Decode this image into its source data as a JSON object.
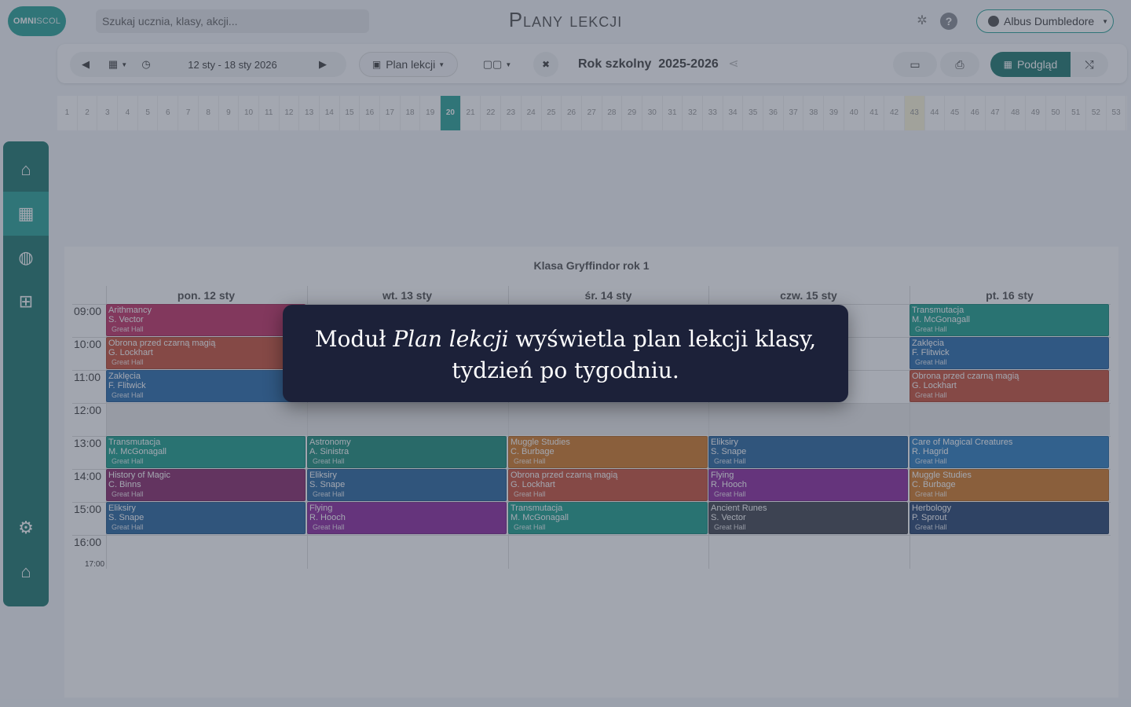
{
  "logo": {
    "bold": "OMNI",
    "lite": "SCOL"
  },
  "search": {
    "placeholder": "Szukaj ucznia, klasy, akcji..."
  },
  "page_title": "Plany lekcji",
  "user": {
    "name": "Albus Dumbledore"
  },
  "toolbar": {
    "date_range": "12 sty - 18 sty 2026",
    "plan_type": "Plan lekcji",
    "school_year_label": "Rok szkolny",
    "school_year_value": "2025-2026",
    "preview_label": "Podgląd"
  },
  "weeks": {
    "numbers": [
      "1",
      "2",
      "3",
      "4",
      "5",
      "6",
      "7",
      "8",
      "9",
      "10",
      "11",
      "12",
      "13",
      "14",
      "15",
      "16",
      "17",
      "18",
      "19",
      "20",
      "21",
      "22",
      "23",
      "24",
      "25",
      "26",
      "27",
      "28",
      "29",
      "30",
      "31",
      "32",
      "33",
      "34",
      "35",
      "36",
      "37",
      "38",
      "39",
      "40",
      "41",
      "42",
      "43",
      "44",
      "45",
      "46",
      "47",
      "48",
      "49",
      "50",
      "51",
      "52",
      "53"
    ],
    "active": "20",
    "highlighted": "43"
  },
  "sidebar": {
    "items": [
      "home-icon",
      "calendar-icon",
      "dashboard-icon",
      "screen-icon",
      "settings-icon",
      "institution-icon"
    ]
  },
  "timetable": {
    "title": "Klasa Gryffindor rok 1",
    "days": [
      "pon. 12 sty",
      "wt. 13 sty",
      "śr. 14 sty",
      "czw. 15 sty",
      "pt. 16 sty"
    ],
    "times": [
      "09:00",
      "10:00",
      "11:00",
      "12:00",
      "13:00",
      "14:00",
      "15:00",
      "16:00"
    ],
    "end_time": "17:00",
    "lessons": [
      {
        "day": 0,
        "slot": 0,
        "subject": "Arithmancy",
        "teacher": "S. Vector",
        "room": "Great Hall",
        "color": "#c33668"
      },
      {
        "day": 0,
        "slot": 1,
        "subject": "Obrona przed czarną magią",
        "teacher": "G. Lockhart",
        "room": "Great Hall",
        "color": "#c8553f"
      },
      {
        "day": 0,
        "slot": 2,
        "subject": "Zaklęcia",
        "teacher": "F. Flitwick",
        "room": "Great Hall",
        "color": "#2f6fae"
      },
      {
        "day": 4,
        "slot": 0,
        "subject": "Transmutacja",
        "teacher": "M. McGonagall",
        "room": "Great Hall",
        "color": "#22a08f"
      },
      {
        "day": 4,
        "slot": 1,
        "subject": "Zaklęcia",
        "teacher": "F. Flitwick",
        "room": "Great Hall",
        "color": "#2f6fae"
      },
      {
        "day": 4,
        "slot": 2,
        "subject": "Obrona przed czarną magią",
        "teacher": "G. Lockhart",
        "room": "Great Hall",
        "color": "#c8553f"
      },
      {
        "day": 0,
        "slot": 4,
        "subject": "Transmutacja",
        "teacher": "M. McGonagall",
        "room": "Great Hall",
        "color": "#22a08f"
      },
      {
        "day": 1,
        "slot": 4,
        "subject": "Astronomy",
        "teacher": "A. Sinistra",
        "room": "Great Hall",
        "color": "#21917f"
      },
      {
        "day": 2,
        "slot": 4,
        "subject": "Muggle Studies",
        "teacher": "C. Burbage",
        "room": "Great Hall",
        "color": "#d27d2c"
      },
      {
        "day": 3,
        "slot": 4,
        "subject": "Eliksiry",
        "teacher": "S. Snape",
        "room": "Great Hall",
        "color": "#2e6aa1"
      },
      {
        "day": 4,
        "slot": 4,
        "subject": "Care of Magical Creatures",
        "teacher": "R. Hagrid",
        "room": "Great Hall",
        "color": "#3280c0"
      },
      {
        "day": 0,
        "slot": 5,
        "subject": "History of Magic",
        "teacher": "C. Binns",
        "room": "Great Hall",
        "color": "#8a2f6e"
      },
      {
        "day": 1,
        "slot": 5,
        "subject": "Eliksiry",
        "teacher": "S. Snape",
        "room": "Great Hall",
        "color": "#2e6aa1"
      },
      {
        "day": 2,
        "slot": 5,
        "subject": "Obrona przed czarną magią",
        "teacher": "G. Lockhart",
        "room": "Great Hall",
        "color": "#c8553f"
      },
      {
        "day": 3,
        "slot": 5,
        "subject": "Flying",
        "teacher": "R. Hooch",
        "room": "Great Hall",
        "color": "#8e2fa0"
      },
      {
        "day": 4,
        "slot": 5,
        "subject": "Muggle Studies",
        "teacher": "C. Burbage",
        "room": "Great Hall",
        "color": "#d27d2c"
      },
      {
        "day": 0,
        "slot": 6,
        "subject": "Eliksiry",
        "teacher": "S. Snape",
        "room": "Great Hall",
        "color": "#2e6aa1"
      },
      {
        "day": 1,
        "slot": 6,
        "subject": "Flying",
        "teacher": "R. Hooch",
        "room": "Great Hall",
        "color": "#8e2fa0"
      },
      {
        "day": 2,
        "slot": 6,
        "subject": "Transmutacja",
        "teacher": "M. McGonagall",
        "room": "Great Hall",
        "color": "#22a08f"
      },
      {
        "day": 3,
        "slot": 6,
        "subject": "Ancient Runes",
        "teacher": "S. Vector",
        "room": "Great Hall",
        "color": "#454a55"
      },
      {
        "day": 4,
        "slot": 6,
        "subject": "Herbology",
        "teacher": "P. Sprout",
        "room": "Great Hall",
        "color": "#2d4a75"
      }
    ]
  },
  "tooltip": {
    "prefix": "Moduł ",
    "module": "Plan lekcji",
    "rest_line1": " wyświetla plan lekcji klasy,",
    "line2": "tydzień po tygodniu."
  }
}
